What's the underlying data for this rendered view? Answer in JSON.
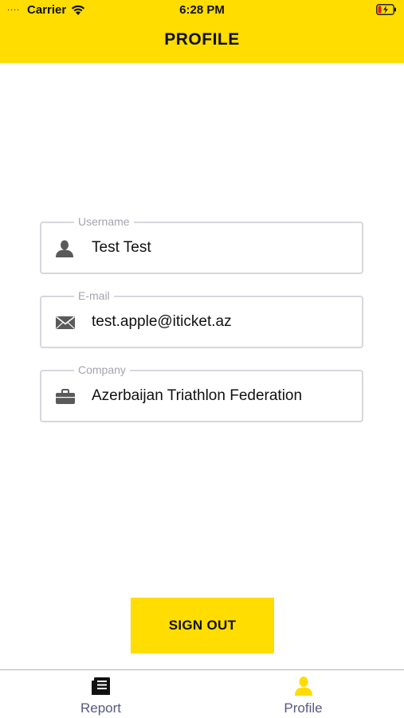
{
  "status_bar": {
    "signal": "....",
    "carrier": "Carrier",
    "time": "6:28 PM"
  },
  "header": {
    "title": "PROFILE"
  },
  "fields": [
    {
      "label": "Username",
      "value": "Test Test",
      "icon": "person-icon"
    },
    {
      "label": "E-mail",
      "value": "test.apple@iticket.az",
      "icon": "envelope-icon"
    },
    {
      "label": "Company",
      "value": "Azerbaijan Triathlon Federation",
      "icon": "briefcase-icon"
    }
  ],
  "actions": {
    "sign_out_label": "SIGN OUT"
  },
  "tabs": [
    {
      "label": "Report",
      "icon": "report-icon",
      "active": false
    },
    {
      "label": "Profile",
      "icon": "person-icon",
      "active": true
    }
  ],
  "colors": {
    "accent": "#FFDD00",
    "field_border": "#d6d8de",
    "label_gray": "#a3a5ad",
    "tab_label": "#555a80"
  }
}
